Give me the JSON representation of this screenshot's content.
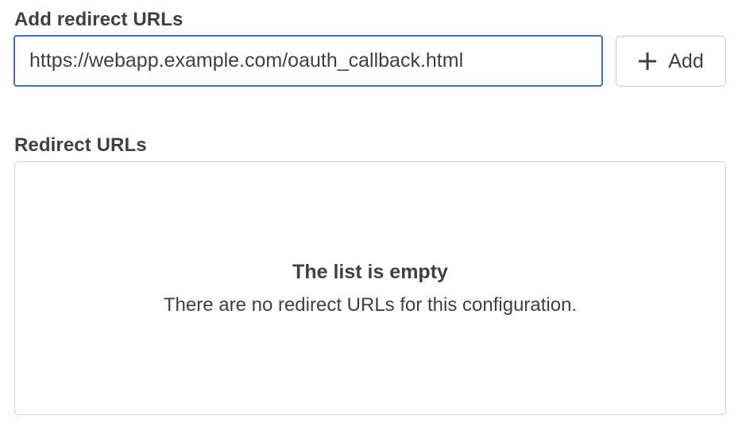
{
  "add_section": {
    "label": "Add redirect URLs",
    "input_value": "https://webapp.example.com/oauth_callback.html",
    "add_button": {
      "icon": "plus-icon",
      "label": "Add"
    }
  },
  "list_section": {
    "label": "Redirect URLs",
    "empty_state": {
      "title": "The list is empty",
      "description": "There are no redirect URLs for this configuration."
    }
  },
  "colors": {
    "input_focus_border": "#3b73c8",
    "text": "#404040",
    "border": "#c7c7c7"
  }
}
